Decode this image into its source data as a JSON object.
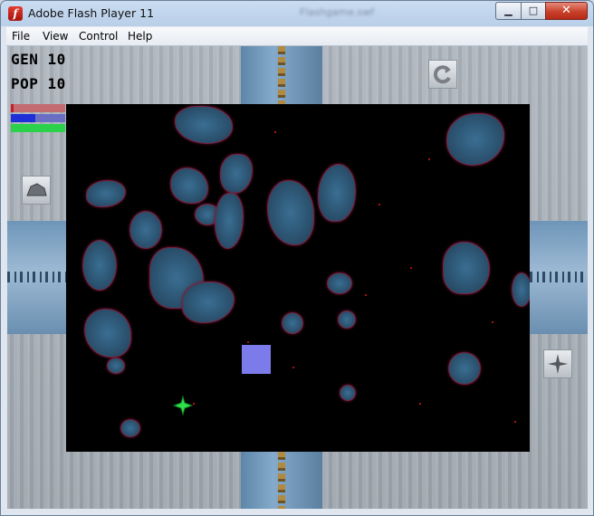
{
  "window": {
    "title": "Adobe Flash Player 11",
    "blurred_title_text": "Flashgame.swf",
    "controls": {
      "minimize": "▁",
      "maximize": "□",
      "close": "✕"
    }
  },
  "menu": {
    "items": [
      "File",
      "View",
      "Control",
      "Help"
    ]
  },
  "hud": {
    "gen_label": "GEN 10",
    "pop_label": "POP 10",
    "bars": [
      {
        "name": "red-bar",
        "color": "#c91d25",
        "value": 0.05
      },
      {
        "name": "blue-bar",
        "color": "#1f2fd8",
        "value": 0.45
      },
      {
        "name": "green-bar",
        "color": "#2bd14a",
        "value": 1.0
      }
    ]
  },
  "buttons": {
    "restart_icon": "restart-icon",
    "tool_icon": "rock-tool-icon",
    "spark_icon": "spark-tool-icon"
  },
  "colors": {
    "game_bg": "#000000",
    "player": "#7b7bea",
    "cell": "#2ee04a"
  }
}
